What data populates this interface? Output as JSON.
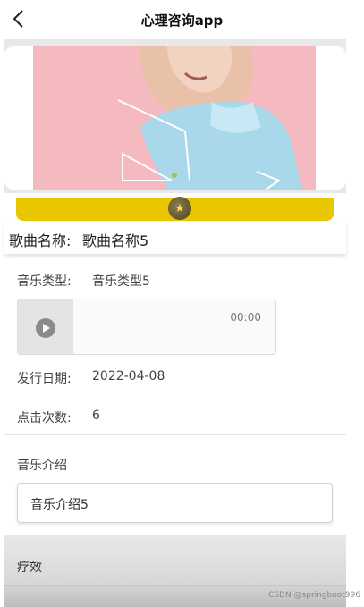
{
  "header": {
    "title": "心理咨询app",
    "back_icon": "chevron-left-icon"
  },
  "player_progress": {
    "position_fraction": 0.5,
    "color": "#e8c600"
  },
  "song": {
    "label": "歌曲名称:",
    "value": "歌曲名称5"
  },
  "fields": {
    "music_type_label": "音乐类型:",
    "music_type_value": "音乐类型5",
    "release_date_label": "发行日期:",
    "release_date_value": "2022-04-08",
    "clicks_label": "点击次数:",
    "clicks_value": "6"
  },
  "audio": {
    "time": "00:00",
    "play_icon": "play-icon"
  },
  "intro": {
    "label": "音乐介绍",
    "value": "音乐介绍5"
  },
  "effect": {
    "label": "疗效"
  },
  "watermark": "CSDN @springboot996"
}
